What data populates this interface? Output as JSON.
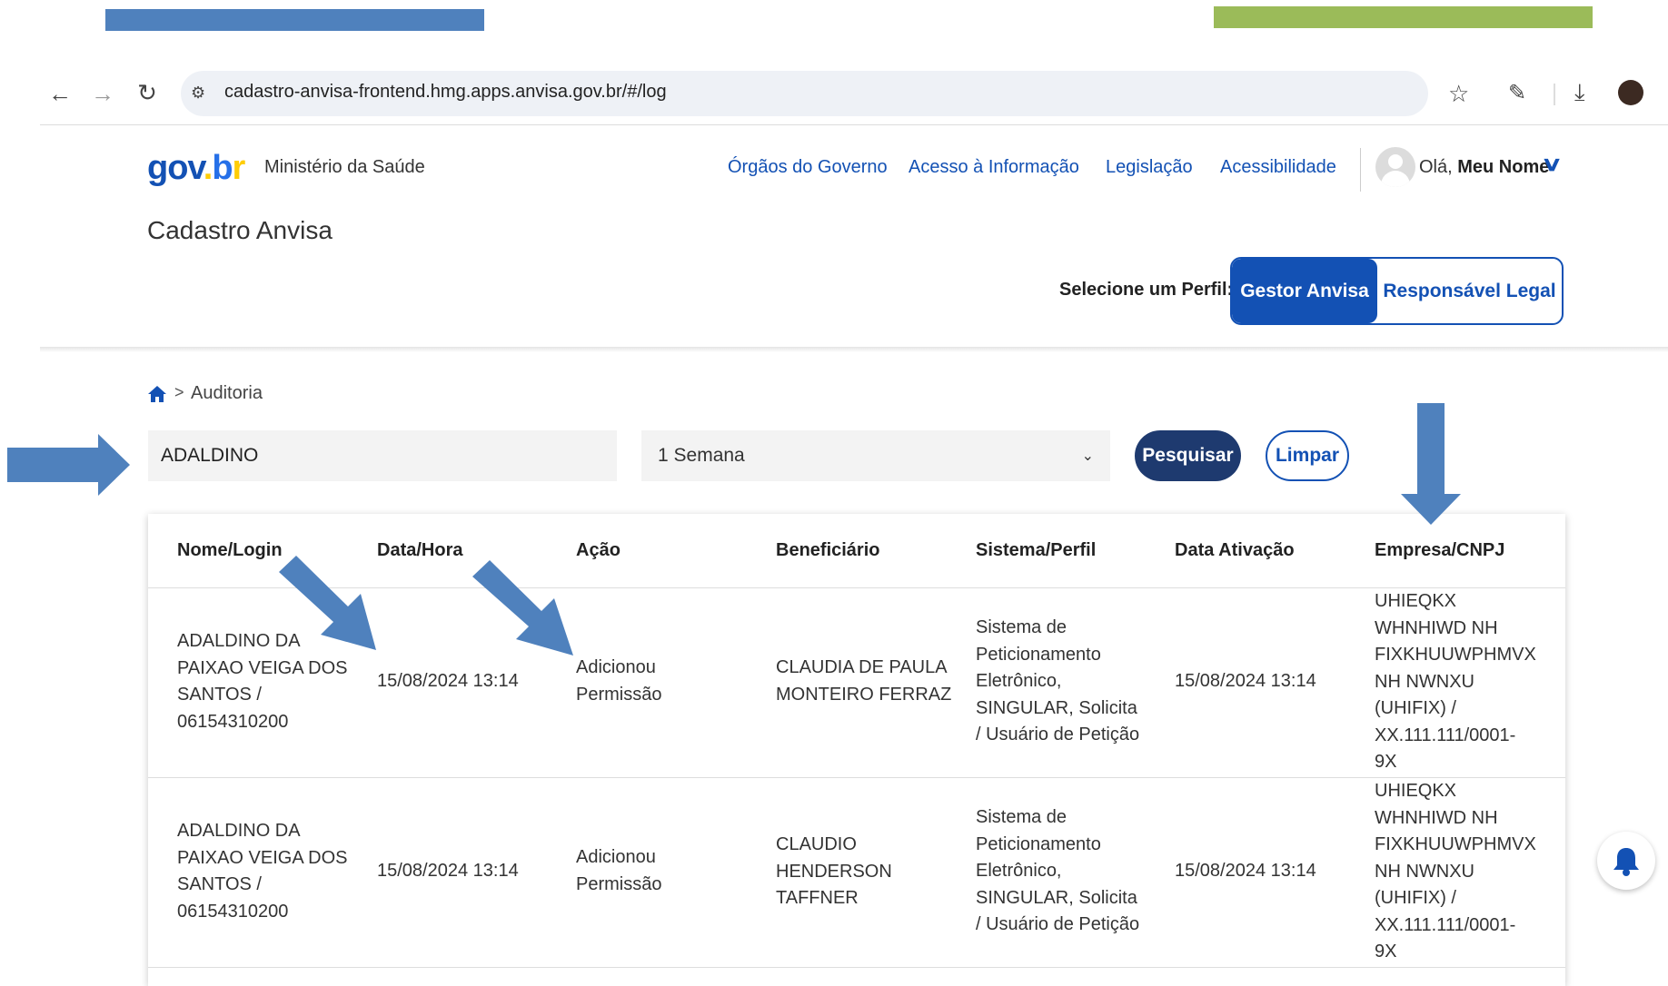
{
  "browser": {
    "url": "cadastro-anvisa-frontend.hmg.apps.anvisa.gov.br/#/log"
  },
  "header": {
    "logo": "gov.br",
    "ministerio": "Ministério da Saúde",
    "links": [
      "Órgãos do Governo",
      "Acesso à Informação",
      "Legislação",
      "Acessibilidade"
    ],
    "greeting": "Olá,",
    "user_name": "Meu Nome",
    "site_title": "Cadastro Anvisa",
    "perfil_label": "Selecione um Perfil:",
    "perfil_options": [
      "Gestor Anvisa",
      "Responsável Legal"
    ]
  },
  "breadcrumb": {
    "current": "Auditoria"
  },
  "search": {
    "value": "ADALDINO",
    "period": "1 Semana",
    "search_button": "Pesquisar",
    "clear_button": "Limpar"
  },
  "table": {
    "columns": [
      "Nome/Login",
      "Data/Hora",
      "Ação",
      "Beneficiário",
      "Sistema/Perfil",
      "Data Ativação",
      "Empresa/CNPJ"
    ],
    "rows": [
      {
        "nome": [
          "ADALDINO DA",
          "PAIXAO VEIGA DOS",
          "SANTOS /",
          "06154310200"
        ],
        "data_hora": "15/08/2024 13:14",
        "acao": [
          "Adicionou",
          "Permissão"
        ],
        "beneficiario": [
          "CLAUDIA DE PAULA",
          "MONTEIRO FERRAZ"
        ],
        "sistema": [
          "Sistema de",
          "Peticionamento",
          "Eletrônico,",
          "SINGULAR, Solicita",
          "/ Usuário de Petição"
        ],
        "data_ativacao": "15/08/2024 13:14",
        "empresa": [
          "UHIEQKX",
          "WHNHIWD NH",
          "FIXKHUUWPHMVX",
          "NH NWNXU",
          "(UHIFIX) /",
          "XX.111.111/0001-",
          "9X"
        ]
      },
      {
        "nome": [
          "ADALDINO DA",
          "PAIXAO VEIGA DOS",
          "SANTOS /",
          "06154310200"
        ],
        "data_hora": "15/08/2024 13:14",
        "acao": [
          "Adicionou",
          "Permissão"
        ],
        "beneficiario": [
          "CLAUDIO",
          "HENDERSON",
          "TAFFNER"
        ],
        "sistema": [
          "Sistema de",
          "Peticionamento",
          "Eletrônico,",
          "SINGULAR, Solicita",
          "/ Usuário de Petição"
        ],
        "data_ativacao": "15/08/2024 13:14",
        "empresa": [
          "UHIEQKX",
          "WHNHIWD NH",
          "FIXKHUUWPHMVX",
          "NH NWNXU",
          "(UHIFIX) /",
          "XX.111.111/0001-",
          "9X"
        ]
      }
    ]
  },
  "colors": {
    "gov_blue": "#1351b4",
    "annotation_blue": "#4f81bd",
    "annotation_green": "#9bbb59",
    "button_dark": "#1e3a6f"
  },
  "icons": [
    "back-icon",
    "forward-icon",
    "reload-icon",
    "site-settings-icon",
    "star-icon",
    "extensions-icon",
    "download-icon",
    "home-icon",
    "chevron-down-icon",
    "bell-icon",
    "annotation-arrow"
  ]
}
